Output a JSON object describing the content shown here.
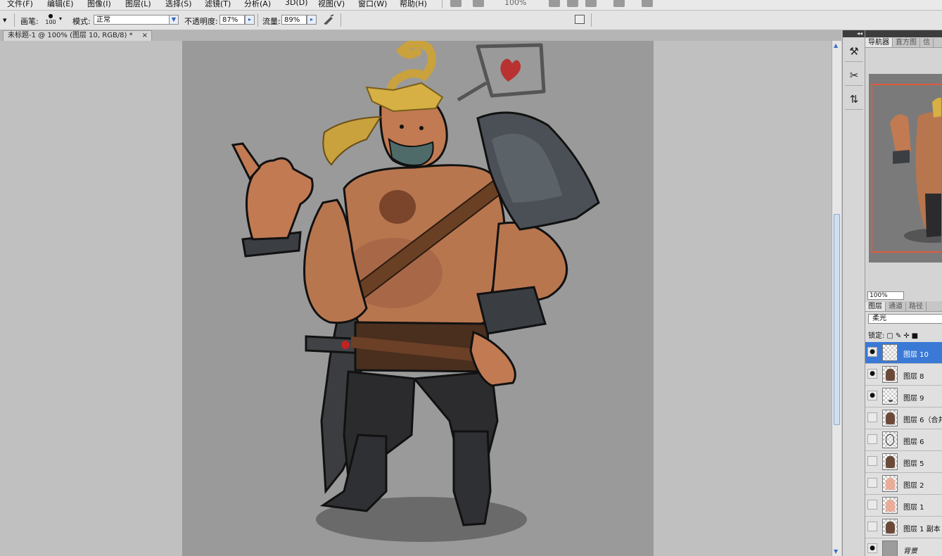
{
  "menu": {
    "items": [
      "文件(F)",
      "编辑(E)",
      "图像(I)",
      "图层(L)",
      "选择(S)",
      "滤镜(T)",
      "分析(A)",
      "3D(D)",
      "视图(V)",
      "窗口(W)",
      "帮助(H)"
    ],
    "zoom": "100%"
  },
  "options": {
    "brush_label": "画笔:",
    "brush_size": "100",
    "mode_label": "模式:",
    "mode_value": "正常",
    "opacity_label": "不透明度:",
    "opacity_value": "87%",
    "flow_label": "流量:",
    "flow_value": "89%"
  },
  "document": {
    "tab_title": "未标题-1 @ 100% (图层 10, RGB/8) *",
    "close_glyph": "×"
  },
  "panels": {
    "collapse_glyph": "◂◂",
    "nav_tabs": [
      "导航器",
      "直方图",
      "信"
    ],
    "nav_zoom": "100%",
    "layer_tabs": [
      "图层",
      "通道",
      "路径"
    ],
    "blend_mode": "柔光",
    "lock_label": "锁定:"
  },
  "layers": [
    {
      "name": "图层 10",
      "visible": true,
      "selected": true,
      "thumb": "empty"
    },
    {
      "name": "图层 8",
      "visible": true,
      "selected": false,
      "thumb": "figure"
    },
    {
      "name": "图层 9",
      "visible": true,
      "selected": false,
      "thumb": "dot"
    },
    {
      "name": "图层 6（合并",
      "visible": false,
      "selected": false,
      "thumb": "figure"
    },
    {
      "name": "图层 6",
      "visible": false,
      "selected": false,
      "thumb": "line"
    },
    {
      "name": "图层 5",
      "visible": false,
      "selected": false,
      "thumb": "figure"
    },
    {
      "name": "图层 2",
      "visible": false,
      "selected": false,
      "thumb": "pink"
    },
    {
      "name": "图层 1",
      "visible": false,
      "selected": false,
      "thumb": "pink"
    },
    {
      "name": "图层 1 副本",
      "visible": false,
      "selected": false,
      "thumb": "figure"
    },
    {
      "name": "背景",
      "visible": true,
      "selected": false,
      "thumb": "bg"
    }
  ]
}
